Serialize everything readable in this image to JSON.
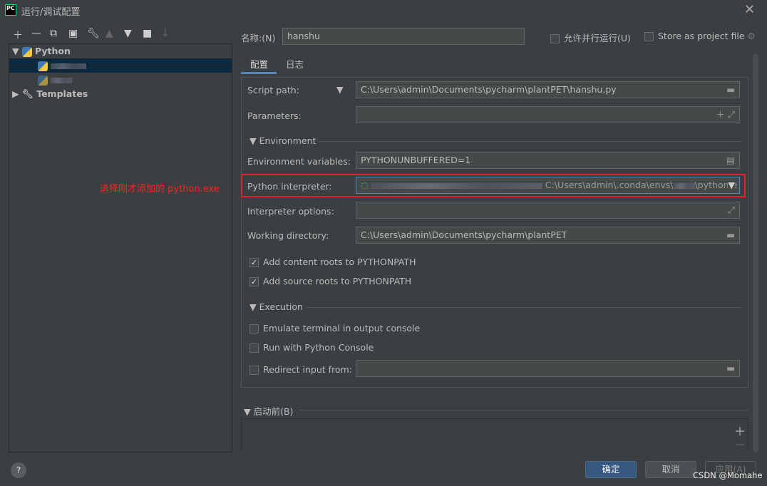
{
  "window": {
    "title": "运行/调试配置",
    "logo": "PC"
  },
  "toolbar": {
    "icons": [
      "plus-icon",
      "minus-icon",
      "copy-icon",
      "save-icon",
      "wrench-icon",
      "arrow-up-icon",
      "arrow-down-icon",
      "new-folder-icon",
      "sort-icon"
    ]
  },
  "tree": {
    "python": "Python",
    "templates": "Templates"
  },
  "name_label": "名称:(N)",
  "name_value": "hanshu",
  "parallel_label": "允许并行运行(U)",
  "store_label": "Store as project file",
  "tabs": [
    "配置",
    "日志"
  ],
  "form": {
    "script_path_label": "Script path:",
    "script_path": "C:\\Users\\admin\\Documents\\pycharm\\plantPET\\hanshu.py",
    "parameters_label": "Parameters:",
    "environment_section": "Environment",
    "env_vars_label": "Environment variables:",
    "env_vars": "PYTHONUNBUFFERED=1",
    "interpreter_label": "Python interpreter:",
    "interpreter_path": "C:\\Users\\admin\\.conda\\envs\\",
    "interpreter_suffix": "\\python.e",
    "interp_options_label": "Interpreter options:",
    "workdir_label": "Working directory:",
    "workdir": "C:\\Users\\admin\\Documents\\pycharm\\plantPET",
    "content_roots": "Add content roots to PYTHONPATH",
    "content_roots_checked": true,
    "source_roots": "Add source roots to PYTHONPATH",
    "source_roots_checked": true,
    "execution_section": "Execution",
    "emulate": "Emulate terminal in output console",
    "python_console": "Run with Python Console",
    "redirect": "Redirect input from:"
  },
  "annotation": "选择刚才添加的 python.exe",
  "annotation_color": "#ff2020",
  "before_launch": "启动前(B)",
  "buttons": {
    "ok": "确定",
    "cancel": "取消",
    "apply": "应用(A)"
  },
  "watermark": "CSDN @Momahe"
}
